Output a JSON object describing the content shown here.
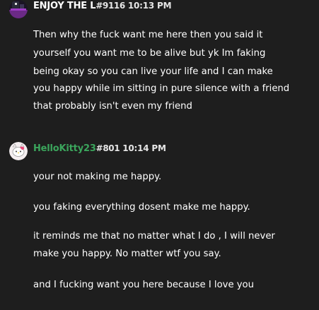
{
  "messages": [
    {
      "username": "ENJOY THE L",
      "tag": "#9116",
      "timestamp": "10:13 PM",
      "username_color": "#ffffff",
      "lines": [
        "Then why the fuck want me here then you said it",
        "yourself you want me to be alive but yk Im faking",
        "being okay so you can live your life and I can make",
        "you happy while im sitting in pure silence with a friend",
        "that probably isn't even my friend"
      ]
    },
    {
      "username": "HelloKitty23",
      "tag": "#801",
      "timestamp": "10:14 PM",
      "username_color": "#3ba55c",
      "paragraphs": [
        {
          "lines": [
            "your not making me happy."
          ]
        },
        {
          "lines": [
            "you faking everything dosent make me happy."
          ]
        },
        {
          "lines": [
            "it reminds me that no matter what I do , I will never",
            "make you happy. No matter wtf you say."
          ]
        },
        {
          "lines": [
            "and I fucking want you here because I love you"
          ]
        }
      ]
    }
  ]
}
